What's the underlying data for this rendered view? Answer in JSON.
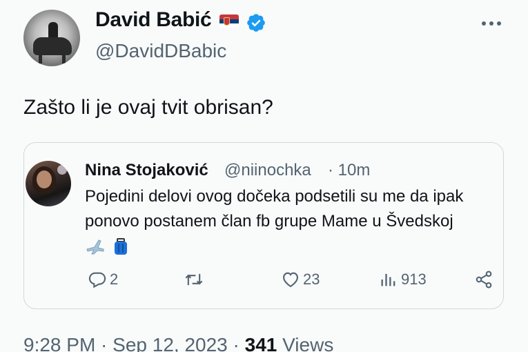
{
  "tweet": {
    "author_name": "David Babić",
    "author_handle": "@DavidDBabic",
    "text": "Zašto li je ovaj tvit obrisan?",
    "icons": {
      "flag": "serbia-flag-icon",
      "verified": "verified-badge-icon",
      "more": "more-options-icon"
    },
    "colors": {
      "verified": "#1d9bf0",
      "secondary_text": "#536471"
    }
  },
  "quoted_tweet": {
    "author_name": "Nina Stojaković",
    "author_handle": "@niinochka",
    "time": "· 10m",
    "text_line1": "Pojedini delovi ovog dočeka podsetili su me da ipak",
    "text_line2": "ponovo postanem član fb grupe Mame u Švedskoj",
    "emojis": [
      "airplane-emoji",
      "luggage-emoji"
    ],
    "actions": {
      "replies": "2",
      "retweets": "",
      "likes": "23",
      "views": "913"
    }
  },
  "footer": {
    "time": "9:28 PM · Sep 12, 2023 · ",
    "views_count": "341",
    "views_label": " Views"
  }
}
